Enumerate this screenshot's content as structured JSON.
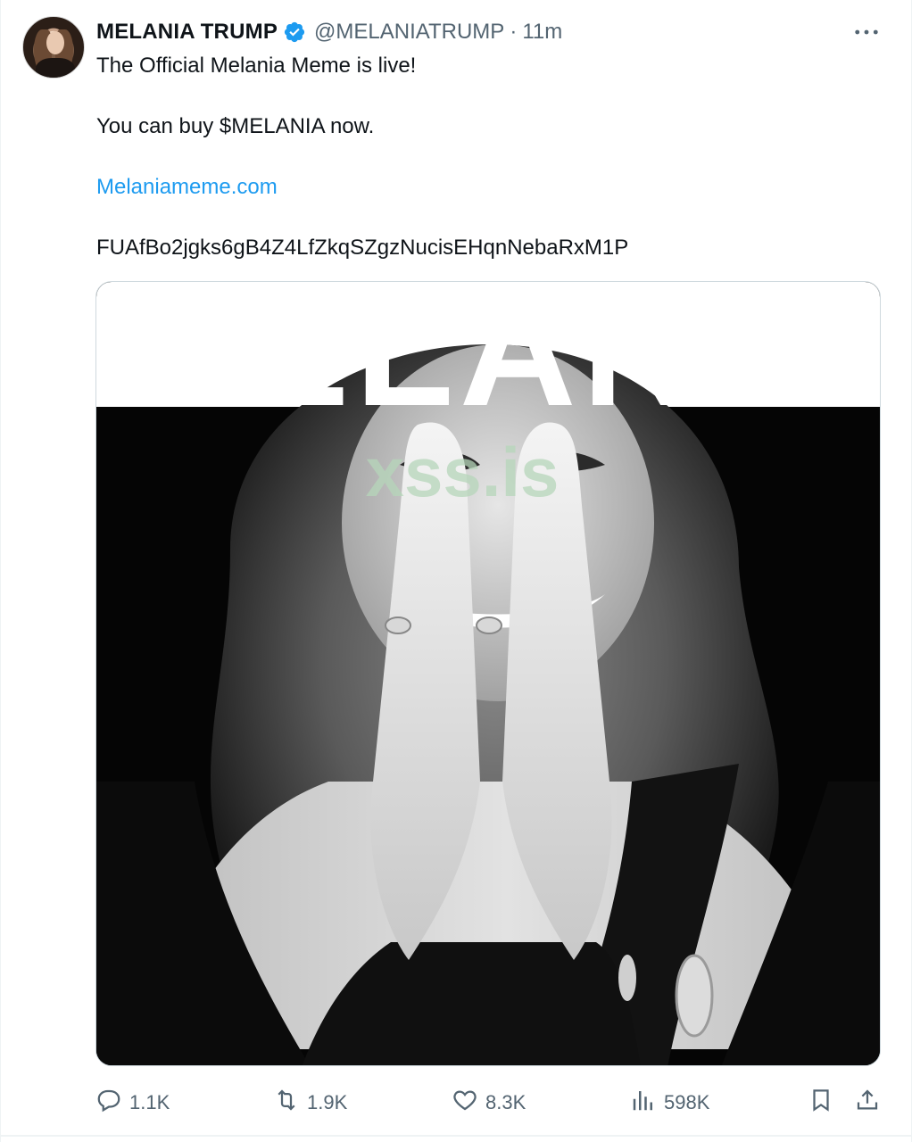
{
  "author": {
    "display_name": "MELANIA TRUMP",
    "handle": "@MELANIATRUMP",
    "separator": "·",
    "time": "11m",
    "verified": true
  },
  "tweet": {
    "line1": "The Official Melania Meme is live!",
    "line2": "You can buy $MELANIA now.",
    "link": "Melaniameme.com",
    "line4": "FUAfBo2jgks6gB4Z4LfZkqSZgzNucisEHqnNebaRxM1P"
  },
  "media": {
    "headline": "MELANIA",
    "watermark": "xss.is"
  },
  "actions": {
    "replies": "1.1K",
    "reposts": "1.9K",
    "likes": "8.3K",
    "views": "598K"
  },
  "colors": {
    "verified_blue": "#1d9bf0",
    "link_blue": "#1d9bf0",
    "secondary_text": "#536471"
  }
}
